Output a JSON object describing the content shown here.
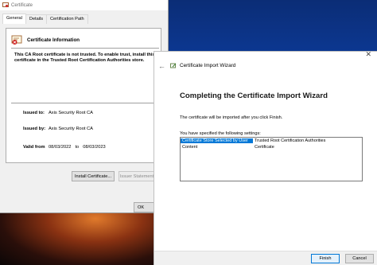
{
  "certificate_window": {
    "title": "Certificate",
    "tabs": [
      "General",
      "Details",
      "Certification Path"
    ],
    "info_title": "Certificate Information",
    "warning": "This CA Root certificate is not trusted. To enable trust, install this certificate in the Trusted Root Certification Authorities store.",
    "issued_to_label": "Issued to:",
    "issued_to": "Axis Security Root CA",
    "issued_by_label": "Issued by:",
    "issued_by": "Axis Security Root CA",
    "valid_from_label": "Valid from",
    "valid_from": "08/03/2022",
    "valid_to_word": "to",
    "valid_to": "08/03/2023",
    "install_button": "Install Certificate...",
    "issuer_button": "Issuer Statement",
    "ok_button": "OK"
  },
  "import_wizard": {
    "title": "Certificate Import Wizard",
    "close_glyph": "✕",
    "back_glyph": "←",
    "heading": "Completing the Certificate Import Wizard",
    "note": "The certificate will be imported after you click Finish.",
    "settings_label": "You have specified the following settings:",
    "settings": [
      {
        "key": "Certificate Store Selected by User",
        "value": "Trusted Root Certification Authorities"
      },
      {
        "key": "Content",
        "value": "Certificate"
      }
    ],
    "finish_button": "Finish",
    "cancel_button": "Cancel"
  }
}
